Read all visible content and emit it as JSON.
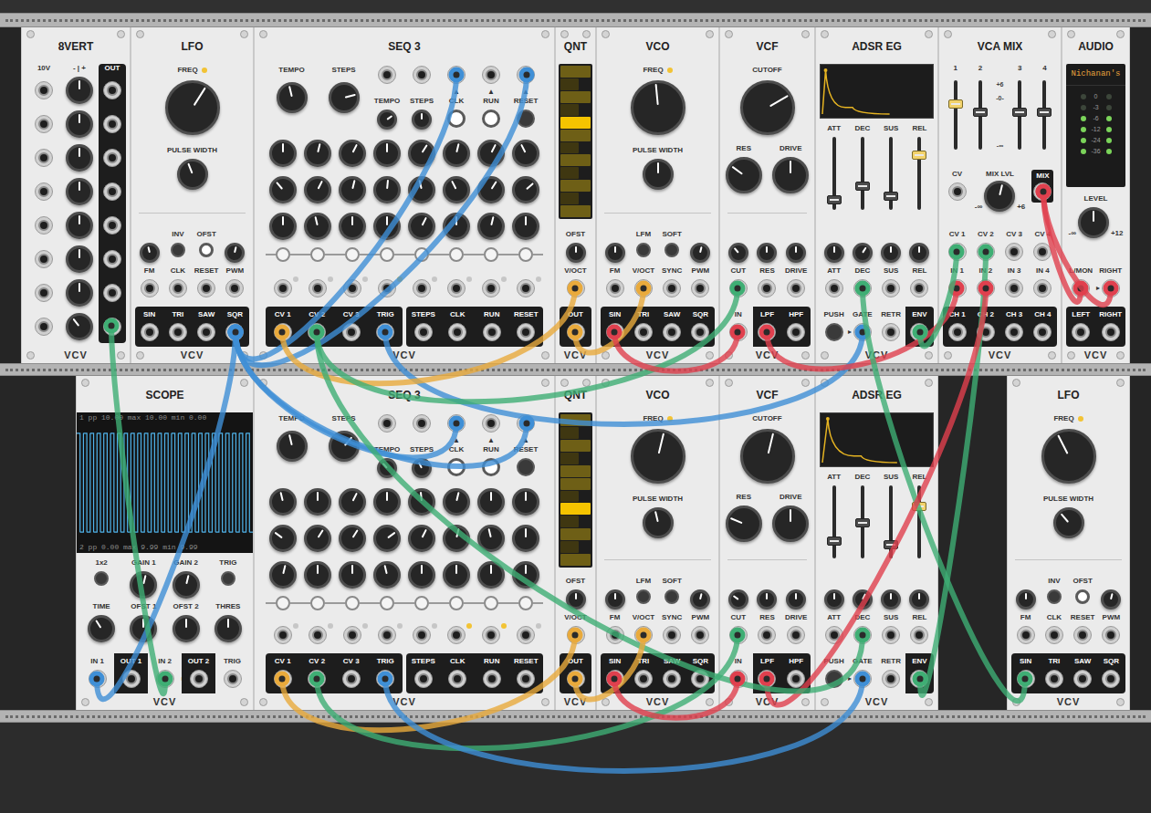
{
  "brand": "VCV",
  "rows": [
    {
      "modules": [
        {
          "kind": "8vert",
          "title": "8VERT",
          "range": "10V",
          "sign": "- | +",
          "out": "OUT",
          "knobs": [
            0.5,
            0.5,
            0.5,
            0.5,
            0.5,
            0.5,
            0.5,
            0.36
          ]
        },
        {
          "kind": "lfo",
          "title": "LFO",
          "light": true,
          "freq": {
            "label": "FREQ",
            "level": 0.62
          },
          "pw": {
            "label": "PULSE WIDTH",
            "level": 0.42
          },
          "switches": [
            {
              "label": "INV",
              "on": false
            },
            {
              "label": "OFST",
              "on": true
            }
          ],
          "attens": [
            0.45,
            0.55
          ],
          "inputs": [
            "FM",
            "CLK",
            "RESET",
            "PWM"
          ],
          "outputs": [
            "SIN",
            "TRI",
            "SAW",
            "SQR"
          ]
        },
        {
          "kind": "seq3",
          "title": "SEQ 3",
          "tempo": {
            "label": "TEMPO",
            "level": 0.45
          },
          "steps": {
            "label": "STEPS",
            "level": 0.78
          },
          "jacks": [
            {
              "kind": "knob",
              "label": "TEMPO",
              "level": 0.7
            },
            {
              "kind": "knob",
              "label": "STEPS",
              "level": 0.5
            },
            {
              "kind": "button",
              "label": "CLK",
              "arrow": "▲",
              "on": true
            },
            {
              "kind": "button",
              "label": "RUN",
              "arrow": "▲",
              "on": true
            },
            {
              "kind": "button",
              "label": "RESET",
              "arrow": "▲",
              "on": false
            }
          ],
          "knob_rows": [
            [
              0.5,
              0.55,
              0.6,
              0.5,
              0.62,
              0.55,
              0.6,
              0.4
            ],
            [
              0.35,
              0.6,
              0.55,
              0.52,
              0.45,
              0.4,
              0.62,
              0.68
            ],
            [
              0.5,
              0.45,
              0.5,
              0.5,
              0.6,
              0.5,
              0.55,
              0.5
            ]
          ],
          "step_lights": [
            false,
            false,
            false,
            true,
            false,
            false,
            false,
            false
          ],
          "outputs": [
            "CV 1",
            "CV 2",
            "CV 3",
            "TRIG"
          ],
          "control_outputs": [
            "STEPS",
            "CLK",
            "RUN",
            "RESET"
          ]
        },
        {
          "kind": "qnt",
          "title": "QNT",
          "notes": [
            false,
            false,
            false,
            false,
            true,
            false,
            false,
            false,
            false,
            false,
            false,
            false
          ],
          "offset": {
            "label": "OFST",
            "level": 0.5
          },
          "input": "V/OCT",
          "output": "OUT"
        },
        {
          "kind": "vco",
          "title": "VCO",
          "light": true,
          "freq": {
            "label": "FREQ",
            "level": 0.48
          },
          "pw": {
            "label": "PULSE WIDTH",
            "level": 0.5
          },
          "switches": [
            {
              "label": "LFM",
              "on": false
            },
            {
              "label": "SOFT",
              "on": false
            }
          ],
          "attens": [
            0.5,
            0.55
          ],
          "inputs": [
            "FM",
            "V/OCT",
            "SYNC",
            "PWM"
          ],
          "outputs": [
            "SIN",
            "TRI",
            "SAW",
            "SQR"
          ]
        },
        {
          "kind": "vcf",
          "title": "VCF",
          "cutoff": {
            "label": "CUTOFF",
            "level": 0.72
          },
          "res": {
            "label": "RES",
            "level": 0.3
          },
          "drive": {
            "label": "DRIVE",
            "level": 0.5
          },
          "attens": [
            0.35,
            0.5,
            0.5
          ],
          "inputs": [
            "CUT",
            "RES",
            "DRIVE"
          ],
          "input": "IN",
          "outputs": [
            "LPF",
            "HPF"
          ]
        },
        {
          "kind": "adsr",
          "title": "ADSR EG",
          "sliders": [
            {
              "label": "ATT",
              "level": 0.08,
              "lit": false
            },
            {
              "label": "DEC",
              "level": 0.3,
              "lit": false
            },
            {
              "label": "SUS",
              "level": 0.15,
              "lit": false
            },
            {
              "label": "REL",
              "level": 0.78,
              "lit": true
            }
          ],
          "attens": [
            0.5,
            0.62,
            0.5,
            0.5
          ],
          "inputs": [
            "ATT",
            "DEC",
            "SUS",
            "REL"
          ],
          "push": {
            "label": "PUSH",
            "arrow": "▸"
          },
          "gate": "GATE",
          "retr": "RETR",
          "output": "ENV"
        },
        {
          "kind": "vcamix",
          "title": "VCA MIX",
          "faders": [
            {
              "label": "1",
              "level": 0.68,
              "lit": true
            },
            {
              "label": "2",
              "level": 0.55,
              "lit": false
            },
            {
              "label": "3",
              "level": 0.55,
              "lit": false
            },
            {
              "label": "4",
              "level": 0.55,
              "lit": false
            }
          ],
          "scale": [
            "+6",
            "-0-",
            "-∞"
          ],
          "cv": "CV",
          "mix": {
            "label": "MIX LVL",
            "level": 0.55,
            "min": "-∞",
            "max": "+6"
          },
          "mix_out": "MIX",
          "cv_inputs": [
            "CV 1",
            "CV 2",
            "CV 3",
            "CV 4"
          ],
          "inputs": [
            "IN 1",
            "IN 2",
            "IN 3",
            "IN 4"
          ],
          "outputs": [
            "CH 1",
            "CH 2",
            "CH 3",
            "CH 4"
          ]
        },
        {
          "kind": "audio",
          "title": "AUDIO",
          "device": "Nichanan's",
          "meter": [
            {
              "label": "0",
              "on": false
            },
            {
              "label": "-3",
              "on": false
            },
            {
              "label": "-6",
              "on": true
            },
            {
              "label": "-12",
              "on": true
            },
            {
              "label": "-24",
              "on": true
            },
            {
              "label": "-36",
              "on": true
            }
          ],
          "level": {
            "label": "LEVEL",
            "level": 0.5,
            "min": "-∞",
            "max": "+12"
          },
          "inputs": [
            {
              "label": "L/MON",
              "arrow": "▸"
            },
            {
              "label": "RIGHT"
            }
          ],
          "outputs": [
            "LEFT",
            "RIGHT"
          ]
        }
      ]
    },
    {
      "modules": [
        {
          "kind": "blank"
        },
        {
          "kind": "scope",
          "title": "SCOPE",
          "readout1": "1 pp 10.00 max 10.00 min 0.00",
          "readout2": "2 pp 0.00 max 9.99 min 9.99",
          "wave": [
            10,
            0,
            10,
            0,
            10,
            0,
            10,
            0,
            10,
            0,
            10,
            0,
            10,
            0,
            10,
            0,
            10,
            0,
            10,
            0,
            10,
            0,
            10,
            0,
            10,
            0,
            10,
            0,
            10,
            0,
            10,
            0,
            10,
            0,
            10,
            0,
            10,
            0,
            10,
            0,
            10,
            0,
            10,
            0,
            10,
            0,
            10,
            0,
            10,
            0,
            10,
            0
          ],
          "mode": {
            "label": "1x2",
            "on": false
          },
          "gains": [
            {
              "label": "GAIN 1",
              "level": 0.55
            },
            {
              "label": "GAIN 2",
              "level": 0.55
            }
          ],
          "trig": {
            "label": "TRIG",
            "on": false
          },
          "knobs": [
            {
              "label": "TIME",
              "level": 0.38
            },
            {
              "label": "OFST 1",
              "level": 0.5
            },
            {
              "label": "OFST 2",
              "level": 0.5
            },
            {
              "label": "THRES",
              "level": 0.5
            }
          ],
          "ports": [
            {
              "label": "IN 1",
              "kind": "input"
            },
            {
              "label": "OUT 1",
              "kind": "output"
            },
            {
              "label": "IN 2",
              "kind": "input",
              "arrow": "▸"
            },
            {
              "label": "OUT 2",
              "kind": "output"
            },
            {
              "label": "TRIG",
              "kind": "input"
            }
          ]
        },
        {
          "kind": "seq3",
          "title": "SEQ 3",
          "tempo": {
            "label": "TEMPO",
            "level": 0.45
          },
          "steps": {
            "label": "STEPS",
            "level": 0.65
          },
          "jacks": [
            {
              "kind": "knob",
              "label": "TEMPO",
              "level": 0.35
            },
            {
              "kind": "knob",
              "label": "STEPS",
              "level": 0.4
            },
            {
              "kind": "button",
              "label": "CLK",
              "arrow": "▲",
              "on": true
            },
            {
              "kind": "button",
              "label": "RUN",
              "arrow": "▲",
              "on": true
            },
            {
              "kind": "button",
              "label": "RESET",
              "arrow": "▲",
              "on": false
            }
          ],
          "knob_rows": [
            [
              0.45,
              0.5,
              0.6,
              0.5,
              0.48,
              0.55,
              0.5,
              0.5
            ],
            [
              0.3,
              0.62,
              0.62,
              0.7,
              0.6,
              0.55,
              0.45,
              0.5
            ],
            [
              0.55,
              0.5,
              0.5,
              0.45,
              0.5,
              0.5,
              0.5,
              0.5
            ]
          ],
          "step_lights": [
            false,
            false,
            false,
            false,
            false,
            true,
            true,
            false
          ],
          "outputs": [
            "CV 1",
            "CV 2",
            "CV 3",
            "TRIG"
          ],
          "control_outputs": [
            "STEPS",
            "CLK",
            "RUN",
            "RESET"
          ]
        },
        {
          "kind": "qnt",
          "title": "QNT",
          "notes": [
            false,
            false,
            false,
            false,
            false,
            false,
            false,
            true,
            false,
            false,
            false,
            false
          ],
          "offset": {
            "label": "OFST",
            "level": 0.5
          },
          "input": "V/OCT",
          "output": "OUT"
        },
        {
          "kind": "vco",
          "title": "VCO",
          "light": true,
          "freq": {
            "label": "FREQ",
            "level": 0.55
          },
          "pw": {
            "label": "PULSE WIDTH",
            "level": 0.45
          },
          "switches": [
            {
              "label": "LFM",
              "on": false
            },
            {
              "label": "SOFT",
              "on": false
            }
          ],
          "attens": [
            0.5,
            0.55
          ],
          "inputs": [
            "FM",
            "V/OCT",
            "SYNC",
            "PWM"
          ],
          "outputs": [
            "SIN",
            "TRI",
            "SAW",
            "SQR"
          ]
        },
        {
          "kind": "vcf",
          "title": "VCF",
          "cutoff": {
            "label": "CUTOFF",
            "level": 0.55
          },
          "res": {
            "label": "RES",
            "level": 0.25
          },
          "drive": {
            "label": "DRIVE",
            "level": 0.5
          },
          "attens": [
            0.3,
            0.5,
            0.5
          ],
          "inputs": [
            "CUT",
            "RES",
            "DRIVE"
          ],
          "input": "IN",
          "outputs": [
            "LPF",
            "HPF"
          ]
        },
        {
          "kind": "adsr",
          "title": "ADSR EG",
          "sliders": [
            {
              "label": "ATT",
              "level": 0.2,
              "lit": false
            },
            {
              "label": "DEC",
              "level": 0.48,
              "lit": false
            },
            {
              "label": "SUS",
              "level": 0.15,
              "lit": false
            },
            {
              "label": "REL",
              "level": 0.75,
              "lit": true
            }
          ],
          "attens": [
            0.5,
            0.6,
            0.5,
            0.5
          ],
          "inputs": [
            "ATT",
            "DEC",
            "SUS",
            "REL"
          ],
          "push": {
            "label": "PUSH",
            "arrow": "▸"
          },
          "gate": "GATE",
          "retr": "RETR",
          "output": "ENV"
        },
        {
          "kind": "blank"
        },
        {
          "kind": "lfo",
          "title": "LFO",
          "light": true,
          "freq": {
            "label": "FREQ",
            "level": 0.4
          },
          "pw": {
            "label": "PULSE WIDTH",
            "level": 0.35
          },
          "switches": [
            {
              "label": "INV",
              "on": false
            },
            {
              "label": "OFST",
              "on": true
            }
          ],
          "attens": [
            0.5,
            0.55
          ],
          "inputs": [
            "FM",
            "CLK",
            "RESET",
            "PWM"
          ],
          "outputs": [
            "SIN",
            "TRI",
            "SAW",
            "SQR"
          ]
        }
      ]
    }
  ],
  "cables": [
    {
      "color": "#3f8fd6"
    },
    {
      "color": "#3f8fd6"
    },
    {
      "color": "#3f8fd6"
    },
    {
      "color": "#3f8fd6"
    },
    {
      "color": "#3f8fd6"
    },
    {
      "color": "#3f8fd6"
    },
    {
      "color": "#e9aa3c"
    },
    {
      "color": "#e9aa3c"
    },
    {
      "color": "#3fae74"
    },
    {
      "color": "#e0404e"
    },
    {
      "color": "#e0404e"
    },
    {
      "color": "#3fae74"
    },
    {
      "color": "#e0404e"
    },
    {
      "color": "#e0404e"
    },
    {
      "color": "#3fae74"
    },
    {
      "color": "#3fae74"
    },
    {
      "color": "#e0404e"
    },
    {
      "color": "#3fae74"
    },
    {
      "color": "#3fae74"
    },
    {
      "color": "#e9aa3c"
    },
    {
      "color": "#e9aa3c"
    },
    {
      "color": "#3fae74"
    },
    {
      "color": "#e0404e"
    },
    {
      "color": "#3f8fd6"
    }
  ]
}
